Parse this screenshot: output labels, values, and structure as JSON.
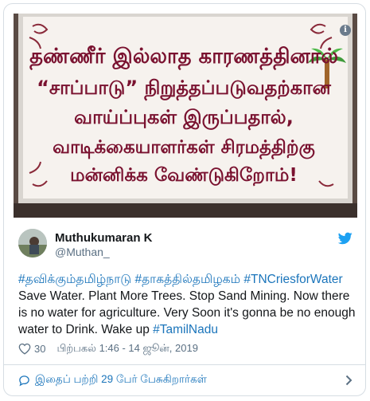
{
  "media": {
    "sign_lines": [
      "தண்ணீர் இல்லாத காரணத்தினால்",
      "“சாப்பாடு” நிறுத்தப்படுவதற்கான",
      "வாய்ப்புகள் இருப்பதால்,",
      "வாடிக்கையாளர்கள் சிரமத்திற்கு",
      "மன்னிக்க வேண்டுகிறோம்!"
    ],
    "info_label": "i"
  },
  "author": {
    "name": "Muthukumaran K",
    "handle": "@Muthan_"
  },
  "tweet": {
    "hashtags_line": [
      "#தவிக்கும்தமிழ்நாடு",
      "#தாகத்தில்தமிழகம்",
      "#TNCriesforWater"
    ],
    "body": "Save Water. Plant More Trees. Stop Sand Mining.  Now there is no water for agriculture. Very Soon it's gonna be no enough water to Drink. Wake up ",
    "trailing_hashtag": "#TamilNadu"
  },
  "meta": {
    "likes": "30",
    "timestamp": "பிற்பகல் 1:46 - 14 ஜூன், 2019"
  },
  "conversation": {
    "label": "இதைப் பற்றி 29 பேர் பேசுகிறார்கள்"
  },
  "colors": {
    "link": "#1b75bb",
    "sign_text": "#7a1230",
    "twitter_blue": "#1da1f2"
  }
}
